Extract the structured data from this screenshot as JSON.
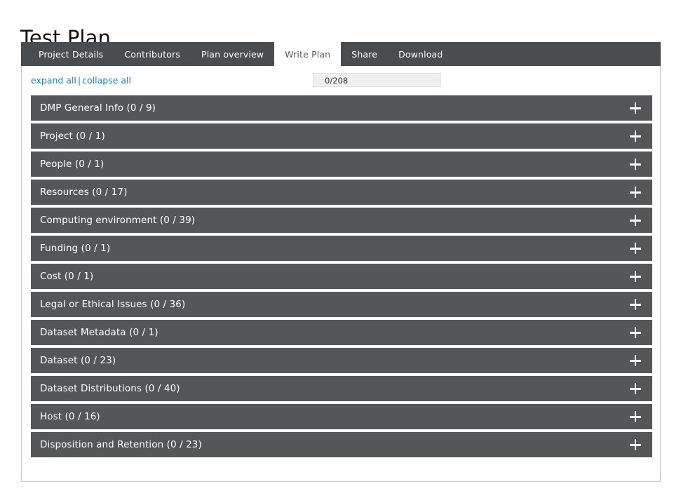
{
  "page_title": "Test Plan",
  "tabs": [
    {
      "label": "Project Details",
      "active": false
    },
    {
      "label": "Contributors",
      "active": false
    },
    {
      "label": "Plan overview",
      "active": false
    },
    {
      "label": "Write Plan",
      "active": true
    },
    {
      "label": "Share",
      "active": false
    },
    {
      "label": "Download",
      "active": false
    }
  ],
  "toolbar": {
    "expand_all": "expand all",
    "separator": "|",
    "collapse_all": "collapse all"
  },
  "progress": {
    "text": "0/208",
    "answered": 0,
    "total": 208
  },
  "sections": [
    {
      "label": "DMP General Info (0 / 9)",
      "name": "DMP General Info",
      "answered": 0,
      "total": 9,
      "expanded": false
    },
    {
      "label": "Project (0 / 1)",
      "name": "Project",
      "answered": 0,
      "total": 1,
      "expanded": false
    },
    {
      "label": "People (0 / 1)",
      "name": "People",
      "answered": 0,
      "total": 1,
      "expanded": false
    },
    {
      "label": "Resources (0 / 17)",
      "name": "Resources",
      "answered": 0,
      "total": 17,
      "expanded": false
    },
    {
      "label": "Computing environment (0 / 39)",
      "name": "Computing environment",
      "answered": 0,
      "total": 39,
      "expanded": false
    },
    {
      "label": "Funding (0 / 1)",
      "name": "Funding",
      "answered": 0,
      "total": 1,
      "expanded": false
    },
    {
      "label": "Cost (0 / 1)",
      "name": "Cost",
      "answered": 0,
      "total": 1,
      "expanded": false
    },
    {
      "label": "Legal or Ethical Issues (0 / 36)",
      "name": "Legal or Ethical Issues",
      "answered": 0,
      "total": 36,
      "expanded": false
    },
    {
      "label": "Dataset Metadata (0 / 1)",
      "name": "Dataset Metadata",
      "answered": 0,
      "total": 1,
      "expanded": false
    },
    {
      "label": "Dataset (0 / 23)",
      "name": "Dataset",
      "answered": 0,
      "total": 23,
      "expanded": false
    },
    {
      "label": "Dataset Distributions (0 / 40)",
      "name": "Dataset Distributions",
      "answered": 0,
      "total": 40,
      "expanded": false
    },
    {
      "label": "Host (0 / 16)",
      "name": "Host",
      "answered": 0,
      "total": 16,
      "expanded": false
    },
    {
      "label": "Disposition and Retention (0 / 23)",
      "name": "Disposition and Retention",
      "answered": 0,
      "total": 23,
      "expanded": false
    }
  ],
  "colors": {
    "tabbar_bg": "#4a4d4f",
    "accordion_bg": "#545658",
    "link": "#2e7aa8",
    "panel_border": "#c8c8c8",
    "progress_bg": "#efefef"
  },
  "icons": {
    "expand_toggle": "plus-icon"
  }
}
